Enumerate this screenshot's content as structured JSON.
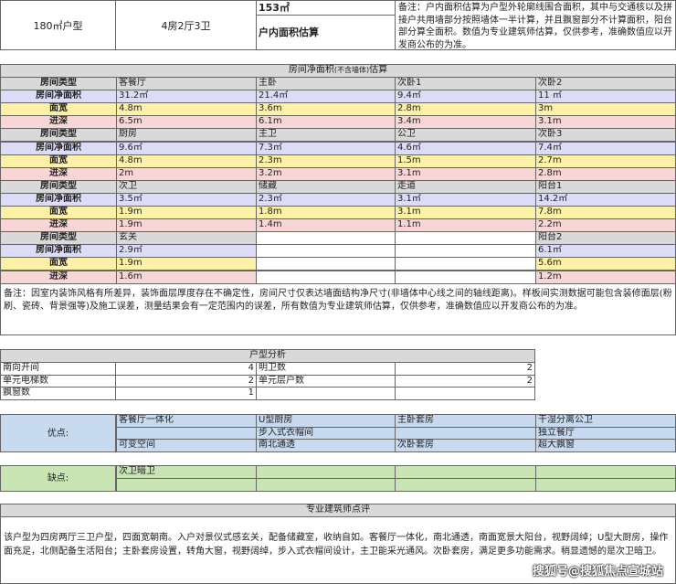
{
  "header": {
    "unit_type": "180㎡户型",
    "layout": "4房2厅3卫",
    "area_value": "153㎡",
    "area_label": "户内面积估算",
    "note": "备注：户内面积估算为户型外轮廓线围合面积，其中与交通核以及拼接户共用墙部分按照墙体一半计算，并且飘窗部分不计算面积，阳台部分算全面积。数值为专业建筑师估算，仅供参考，准确数值应以开发商公布的为准。"
  },
  "room_table": {
    "title": "房间净面积",
    "title_small": "(不含墙体)",
    "title_suffix": "估算",
    "row_labels": [
      "房间类型",
      "房间净面积",
      "面宽",
      "进深"
    ],
    "groups": [
      [
        [
          "客餐厅",
          "31.2㎡",
          "4.8m",
          "6.5m"
        ],
        [
          "主卧",
          "21.4㎡",
          "3.6m",
          "6.1m"
        ],
        [
          "次卧1",
          "9.4㎡",
          "2.8m",
          "3.4m"
        ],
        [
          "次卧2",
          "11 ㎡",
          "3m",
          "3.1m"
        ]
      ],
      [
        [
          "厨房",
          "9.6㎡",
          "4.8m",
          "2m"
        ],
        [
          "主卫",
          "7.3㎡",
          "2.3m",
          "3.2m"
        ],
        [
          "公卫",
          "4.6㎡",
          "1.5m",
          "3.1m"
        ],
        [
          "次卧3",
          "7.4㎡",
          "2.7m",
          "2.8m"
        ]
      ],
      [
        [
          "次卫",
          "3.5㎡",
          "1.9m",
          "1.9m"
        ],
        [
          "储藏",
          "2.3㎡",
          "1.8m",
          "1.4m"
        ],
        [
          "走道",
          "3.1㎡",
          "3.1m",
          "1.1m"
        ],
        [
          "阳台1",
          "14.2㎡",
          "7.8m",
          "2.2m"
        ]
      ],
      [
        [
          "玄关",
          "2.9㎡",
          "1.9m",
          "1.6m"
        ],
        [
          "",
          "",
          "",
          ""
        ],
        [
          "",
          "",
          "",
          ""
        ],
        [
          "阳台2",
          "6.1㎡",
          "5.6m",
          "1.2m"
        ]
      ]
    ],
    "note": "备注：因室内装饰风格有所差异，装饰面层厚度存在不确定性，房间尺寸仅表达墙面结构净尺寸(非墙体中心线之间的轴线距离)。样板间实测数据可能包含装修面层(粉刷、瓷砖、背景强等)及施工误差，测量结果会有一定范围内的误差，所有数值为专业建筑师估算，仅供参考，准确数值应以开发商公布的为准。"
  },
  "analysis": {
    "title": "户型分析",
    "rows": [
      {
        "label": "南向开间",
        "value": "4",
        "label2": "明卫数",
        "value2": "2"
      },
      {
        "label": "单元电梯数",
        "value": "2",
        "label2": "单元层户数",
        "value2": "2"
      },
      {
        "label": "飘窗数",
        "value": "1",
        "label2": "",
        "value2": ""
      }
    ]
  },
  "pros": {
    "label": "优点:",
    "rows": [
      [
        "客餐厅一体化",
        "U型厨房",
        "主卧套房",
        "干湿分离公卫"
      ],
      [
        "",
        "步入式衣帽间",
        "",
        "独立餐厅"
      ],
      [
        "可变空间",
        "南北通透",
        "次卧套房",
        "超大飘窗"
      ]
    ]
  },
  "cons": {
    "label": "缺点:",
    "rows": [
      [
        "次卫暗卫",
        "",
        "",
        ""
      ],
      [
        "",
        "",
        "",
        ""
      ]
    ]
  },
  "review": {
    "title": "专业建筑师点评",
    "text": "该户型为四房两厅三卫户型，四面宽朝南。入户对景仪式感玄关，配备储藏室，收纳自如。客餐厅一体化，南北通透，南面宽景大阳台，视野阔绰；U型大厨房，操作面充足，北侧配备生活阳台；主卧套房设置，转角大窗，视野阔绰，步入式衣帽间设计，主卫能采光通风。次卧套房，满足更多功能需求。稍显遗憾的是次卫暗卫。"
  },
  "watermark": "搜狐号@搜狐焦点宣城站"
}
